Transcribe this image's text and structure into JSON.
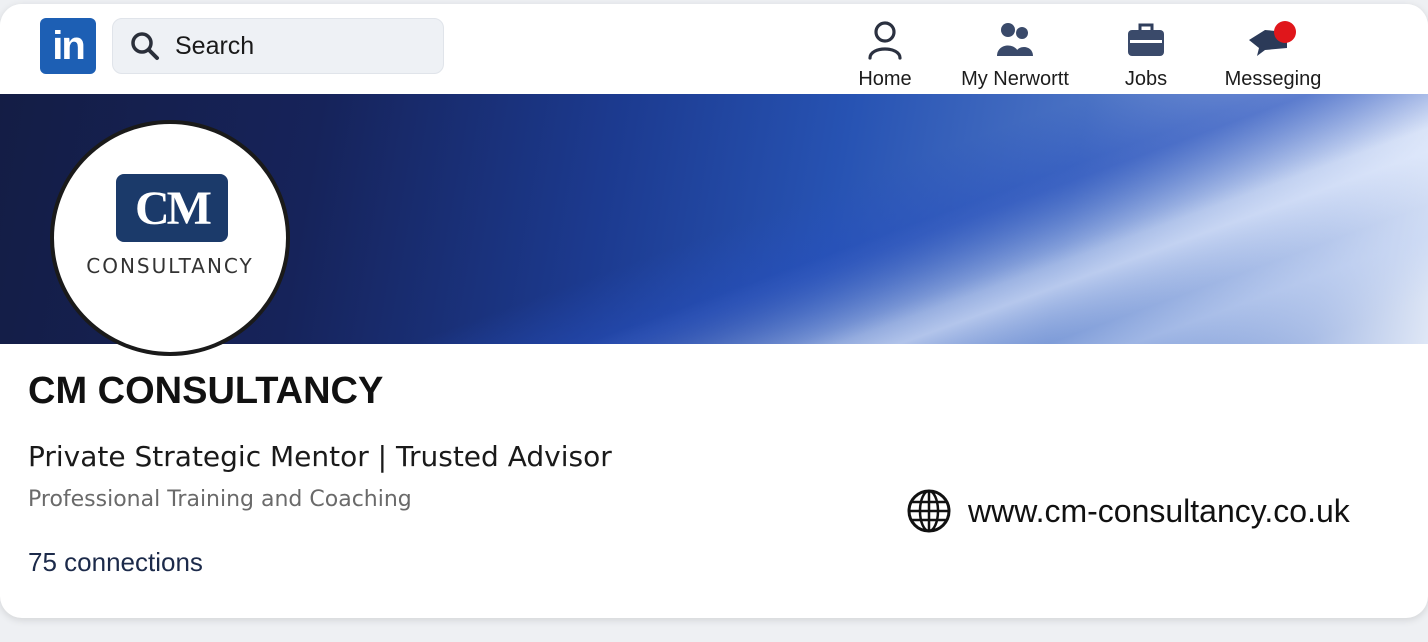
{
  "nav": {
    "logo_text": "in",
    "search_placeholder": "Search",
    "items": [
      {
        "label": "Home",
        "icon": "person-icon"
      },
      {
        "label": "My Nerwortt",
        "icon": "people-icon"
      },
      {
        "label": "Jobs",
        "icon": "briefcase-icon"
      },
      {
        "label": "Messeging",
        "icon": "chat-icon",
        "badge_color": "#e0161b"
      }
    ],
    "brand_color": "#1d5fb4"
  },
  "avatar": {
    "logo_main": "CM",
    "logo_sub": "CONSULTANCY"
  },
  "profile": {
    "name": "CM CONSULTANCY",
    "headline": "Private Strategic Mentor | Trusted Advisor",
    "industry": "Professional Training and Coaching",
    "connections": "75 connections",
    "website": "www.cm-consultancy.co.uk"
  }
}
